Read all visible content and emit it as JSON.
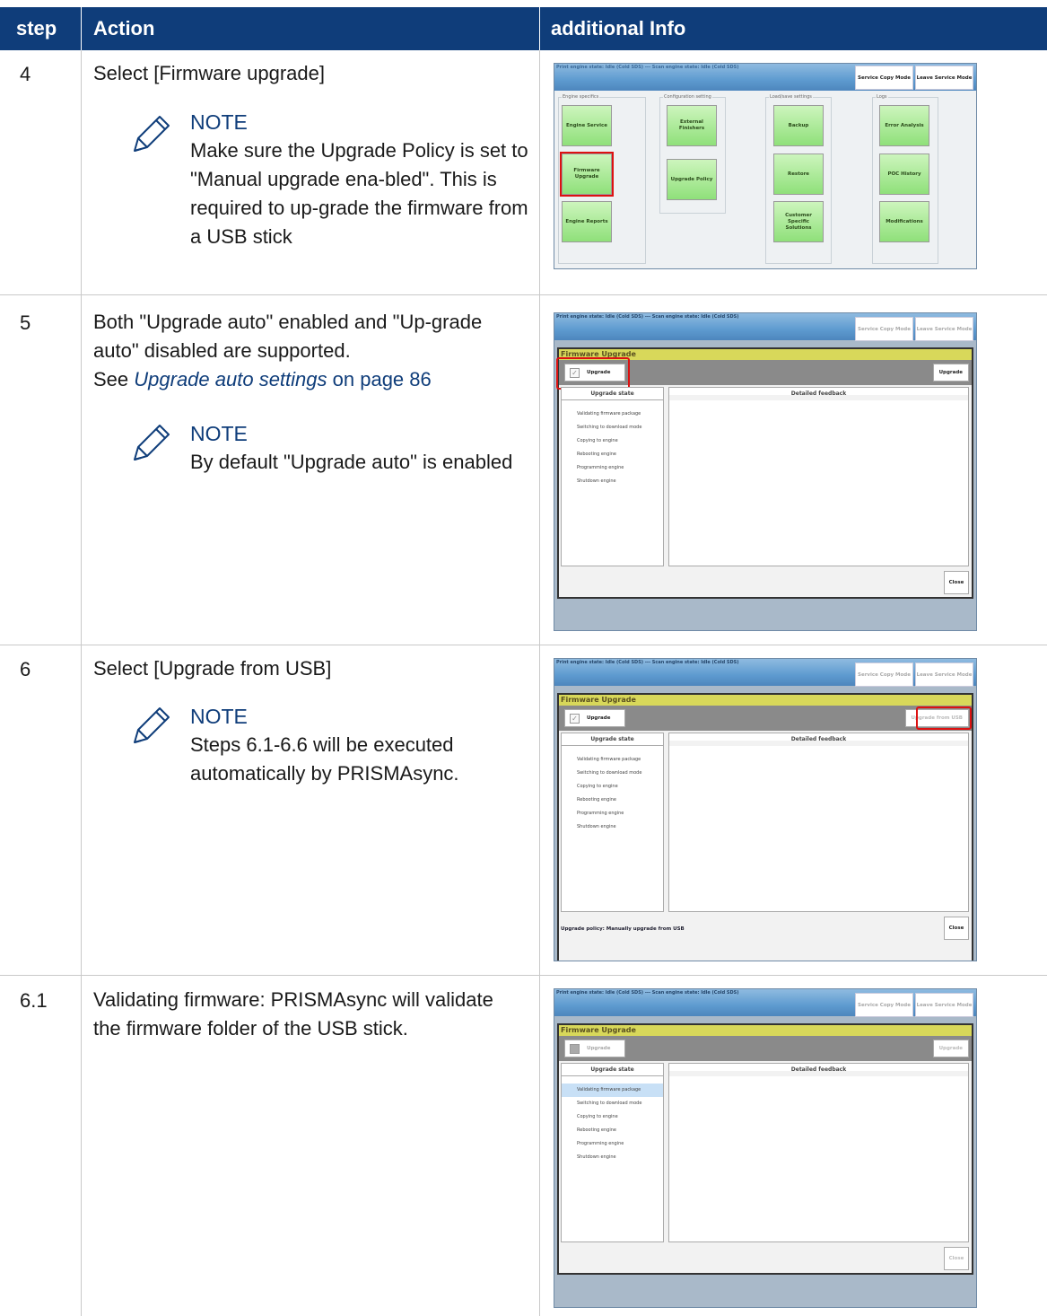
{
  "header": {
    "step": "step",
    "action": "Action",
    "info": "additional Info"
  },
  "rows": [
    {
      "step": "4",
      "action": "Select [Firmware upgrade]",
      "note_title": "NOTE",
      "note_text": "Make sure the Upgrade Policy is set to \"Manual upgrade ena-bled\". This is required to up-grade the firmware from a USB stick"
    },
    {
      "step": "5",
      "action_line1": "Both \"Upgrade auto\" enabled and \"Up-grade auto\" disabled are supported.",
      "action_see": "See ",
      "action_link": "Upgrade auto settings",
      "action_page": " on page 86",
      "note_title": "NOTE",
      "note_text": "By default \"Upgrade auto\" is enabled"
    },
    {
      "step": "6",
      "action": "Select [Upgrade from USB]",
      "note_title": "NOTE",
      "note_text": "Steps 6.1-6.6 will be executed automatically by PRISMAsync."
    },
    {
      "step": "6.1",
      "action": "Validating firmware: PRISMAsync will validate the firmware folder of the USB stick."
    }
  ],
  "screens": {
    "status": "Print engine state: Idle (Cold SDS) --- Scan engine state: Idle (Cold SDS)",
    "service_copy": "Service Copy Mode",
    "leave_service": "Leave Service Mode",
    "groups": [
      "Engine specifics",
      "Configuration setting",
      "Load/save settings",
      "Logs"
    ],
    "buttons": {
      "engine_service": "Engine Service",
      "firmware_upgrade": "Firmware Upgrade",
      "engine_reports": "Engine Reports",
      "external_finishers": "External Finishers",
      "upgrade_policy": "Upgrade Policy",
      "backup": "Backup",
      "restore": "Restore",
      "customer_solutions": "Customer Specific Solutions",
      "error_analysis": "Error Analysis",
      "poc_history": "POC History",
      "modifications": "Modifications"
    },
    "dialog_title": "Firmware Upgrade",
    "upgrade_auto": "Upgrade auto",
    "upgrade": "Upgrade",
    "upgrade_from_usb": "Upgrade from USB",
    "upgrade_state": "Upgrade state",
    "detailed_feedback": "Detailed feedback",
    "states": [
      "Validating firmware package",
      "Switching to download mode",
      "Copying to engine",
      "Rebooting engine",
      "Programming engine",
      "Shutdown engine"
    ],
    "close": "Close",
    "policy": "Upgrade policy: Manually upgrade from USB"
  }
}
